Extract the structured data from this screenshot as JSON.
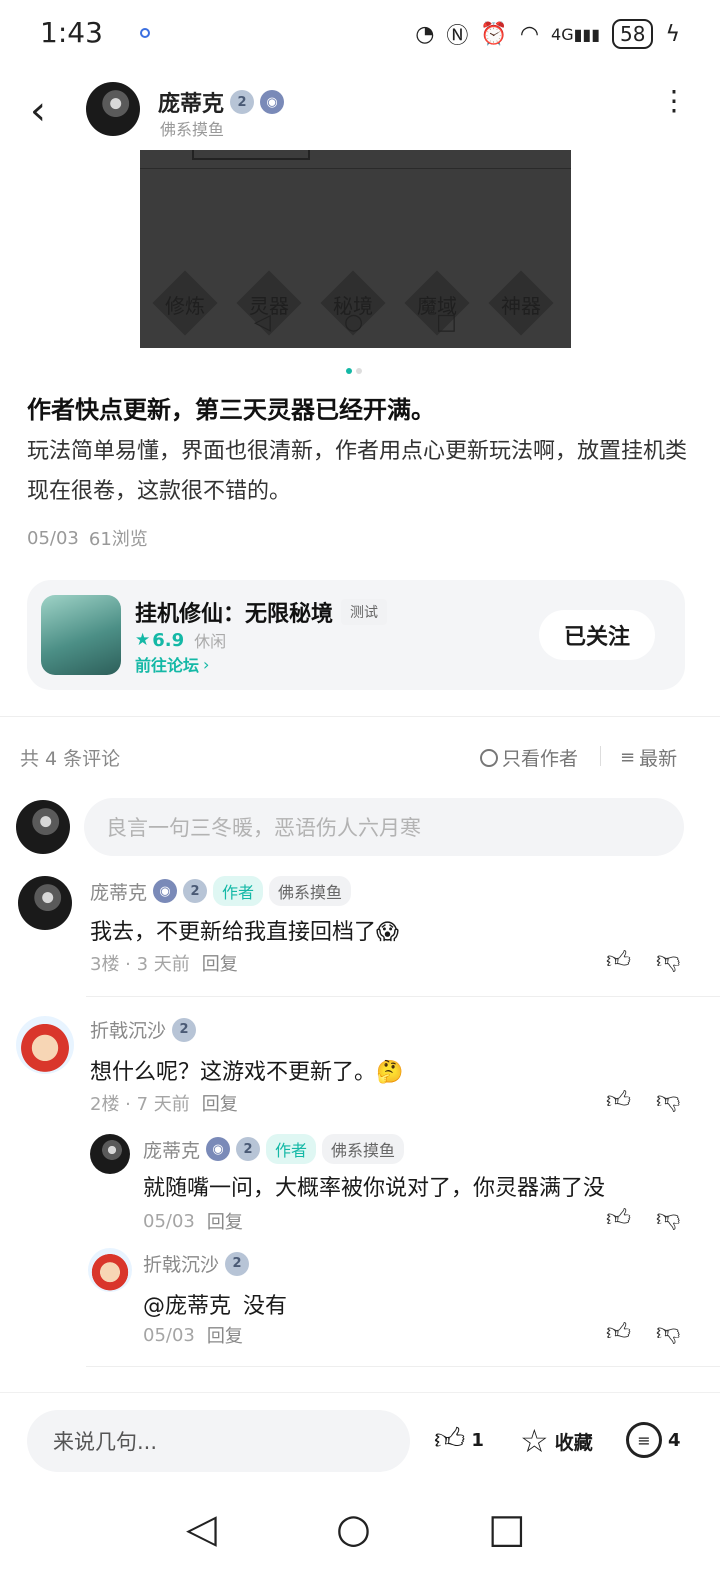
{
  "status_bar": {
    "time": "1:43",
    "icons": [
      "speed-icon",
      "nfc-icon",
      "alarm-icon",
      "wifi-icon",
      "4g-signal-icon"
    ],
    "battery": "58"
  },
  "header": {
    "author_name": "庞蒂克",
    "author_title": "佛系摸鱼",
    "level_badge": "2"
  },
  "image": {
    "labels": [
      "修炼",
      "灵器",
      "秘境",
      "魔域",
      "神器"
    ]
  },
  "post": {
    "title": "作者快点更新，第三天灵器已经开满。",
    "body": "玩法简单易懂，界面也很清新，作者用点心更新玩法啊，放置挂机类现在很卷，这款很不错的。",
    "date": "05/03",
    "views": "61浏览"
  },
  "game_card": {
    "name": "挂机修仙：无限秘境",
    "test_tag": "测试",
    "rating": "6.9",
    "genre": "休闲",
    "forum_link": "前往论坛",
    "follow_label": "已关注"
  },
  "comments_header": {
    "count_label": "共 4 条评论",
    "author_only": "只看作者",
    "sort": "最新"
  },
  "comment_input": {
    "placeholder": "良言一句三冬暖，恶语伤人六月寒"
  },
  "comments": [
    {
      "name": "庞蒂克",
      "author_tag": "作者",
      "title_tag": "佛系摸鱼",
      "text": "我去，不更新给我直接回档了😱",
      "meta": "3楼 · 3 天前",
      "reply": "回复"
    },
    {
      "name": "折戟沉沙",
      "text": "想什么呢？这游戏不更新了。🤔",
      "meta": "2楼 · 7 天前",
      "reply": "回复",
      "replies": [
        {
          "name": "庞蒂克",
          "author_tag": "作者",
          "title_tag": "佛系摸鱼",
          "text": "就随嘴一问，大概率被你说对了，你灵器满了没",
          "meta": "05/03",
          "reply": "回复"
        },
        {
          "name": "折戟沉沙",
          "mention": "@庞蒂克",
          "text": "没有",
          "meta": "05/03",
          "reply": "回复"
        }
      ]
    }
  ],
  "bottom_bar": {
    "placeholder": "来说几句...",
    "like_count": "1",
    "favorite_label": "收藏",
    "comment_count": "4"
  }
}
